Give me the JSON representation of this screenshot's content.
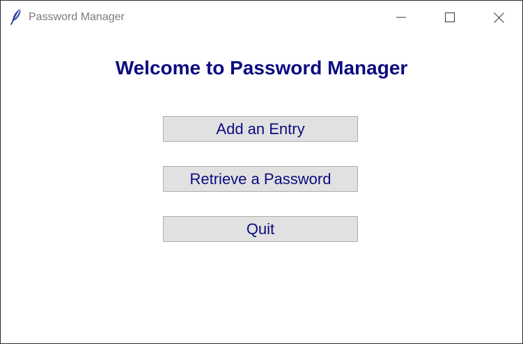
{
  "window": {
    "title": "Password Manager",
    "app_icon": "feather-icon",
    "controls": [
      "minimize-icon",
      "maximize-icon",
      "close-icon"
    ]
  },
  "main": {
    "heading": "Welcome to Password Manager",
    "buttons": [
      {
        "label": "Add an Entry"
      },
      {
        "label": "Retrieve a Password"
      },
      {
        "label": "Quit"
      }
    ]
  },
  "colors": {
    "heading_text": "#0c0c80",
    "button_text": "#0c0c80",
    "button_bg": "#e1e1e1",
    "button_border": "#adadad",
    "title_text": "#7a7a7a"
  }
}
